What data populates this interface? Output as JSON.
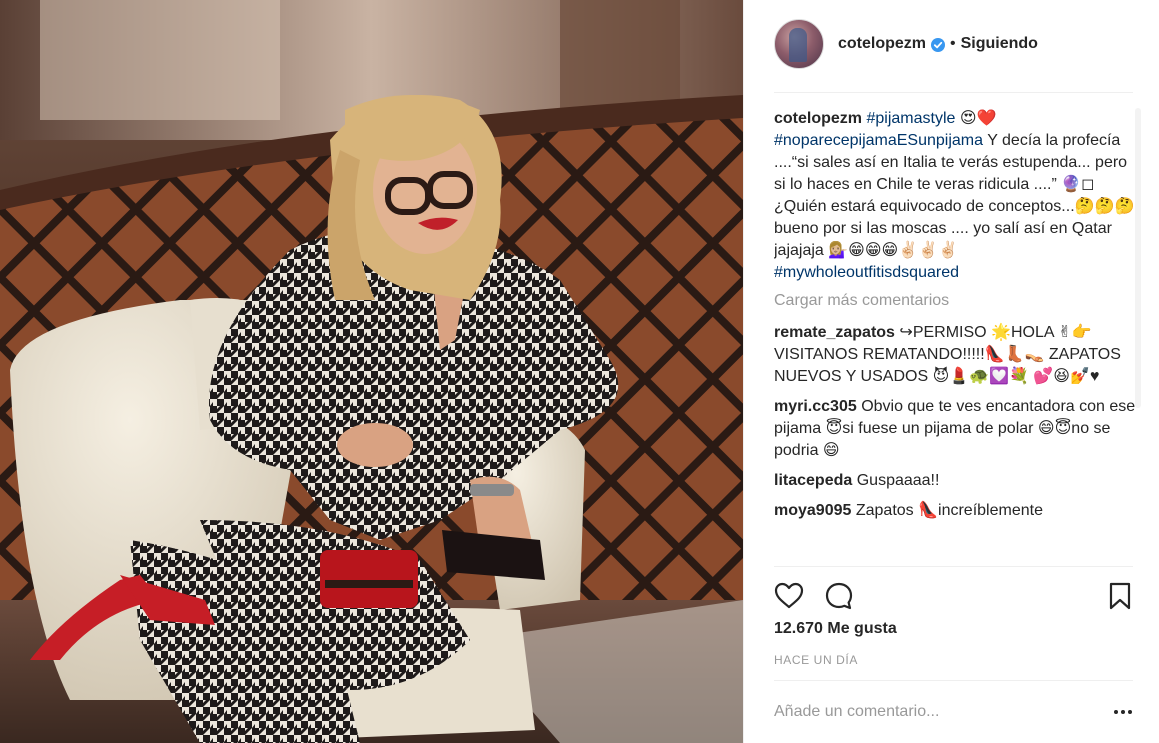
{
  "post": {
    "username": "cotelopezm",
    "separator": "•",
    "follow_state": "Siguiendo"
  },
  "caption": {
    "username": "cotelopezm",
    "hashtag1": "#pijamastyle",
    "emoji1": "😍❤️",
    "hashtag2": "#noparecepijamaESunpijama",
    "text": " Y decía la profecía ....“si sales así en Italia te verás estupenda... pero si lo haces en Chile te veras ridicula ....” 🔮◻ ¿Quién estará equivocado de conceptos...🤔🤔🤔bueno por si las moscas .... yo salí así en Qatar jajajaja 💁🏼‍♀️😁😁😁✌🏻✌🏻✌🏻 ",
    "hashtag3": "#mywholeoutfitisdsquared"
  },
  "load_more": "Cargar más comentarios",
  "comments": [
    {
      "user": "remate_zapatos",
      "text": "↪PERMISO 🌟HOLA ✌👉 VISITANOS REMATANDO!!!!!👠👢👡 ZAPATOS NUEVOS Y USADOS 😈💄🐢💟💐 💕😆💅♥"
    },
    {
      "user": "myri.cc305",
      "text": "Obvio que te ves encantadora con ese pijama 😇si fuese un pijama de polar 😄😇no se podria 😄"
    },
    {
      "user": "litacepeda",
      "text": "Guspaaaa!!"
    },
    {
      "user": "moya9095",
      "text": "Zapatos 👠increíblemente"
    }
  ],
  "icons": {
    "like": "heart-icon",
    "comment": "comment-bubble-icon",
    "save": "bookmark-icon",
    "verified": "verified-badge-icon",
    "more": "more-options-icon"
  },
  "likes_text": "12.670 Me gusta",
  "time_text": "HACE UN DÍA",
  "add_comment": {
    "placeholder": "Añade un comentario..."
  },
  "colors": {
    "hashtag": "#003569",
    "verified": "#3897f0",
    "muted": "#999999",
    "text": "#262626"
  }
}
